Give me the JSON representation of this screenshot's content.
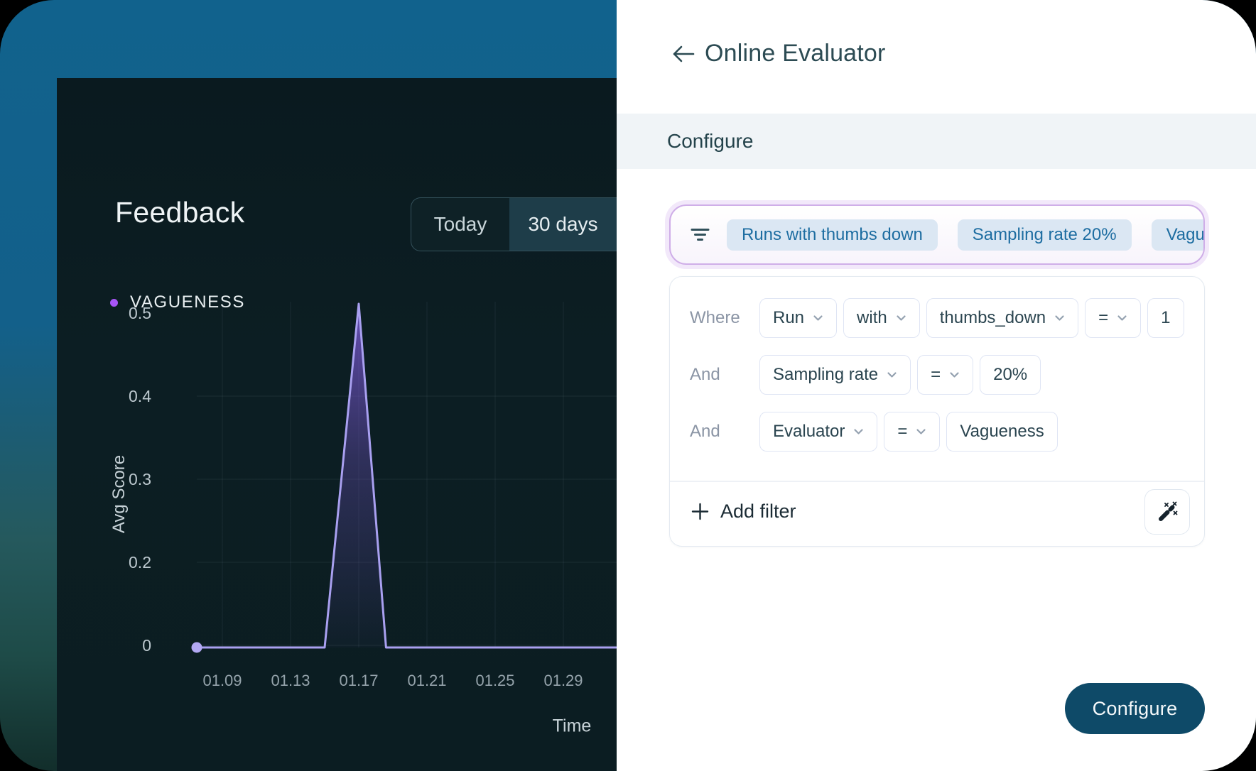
{
  "left_panel": {
    "range_buttons": [
      {
        "label": "Today",
        "active": false
      },
      {
        "label": "30 days",
        "active": true
      }
    ]
  },
  "chart_data": {
    "type": "line",
    "title": "Feedback",
    "legend": [
      {
        "label": "VAGUENESS",
        "color": "#a855f7"
      }
    ],
    "xlabel": "Time",
    "ylabel": "Avg Score",
    "x_ticks": [
      "01.09",
      "01.13",
      "01.17",
      "01.21",
      "01.25",
      "01.29"
    ],
    "x_tick_positions_days": [
      0,
      4,
      8,
      12,
      16,
      20
    ],
    "y_ticks": [
      "0.5",
      "0.4",
      "0.3",
      "0.2",
      "0"
    ],
    "ylim": [
      0,
      0.5
    ],
    "grid": true,
    "series": [
      {
        "name": "VAGUENESS",
        "color": "#a9a0f0",
        "points_days_value": [
          [
            -1.5,
            0
          ],
          [
            6,
            0
          ],
          [
            8,
            0.5
          ],
          [
            9.6,
            0
          ],
          [
            23.1,
            0
          ]
        ]
      }
    ]
  },
  "right_panel": {
    "header": {
      "title": "Online Evaluator",
      "back_icon": "arrow-left"
    },
    "section_title": "Configure",
    "filter_bar": {
      "icon": "filter-lines-icon",
      "chips": [
        "Runs with thumbs down",
        "Sampling rate 20%",
        "Vagueness"
      ]
    },
    "filter_rows": [
      {
        "connector": "Where",
        "fields": [
          {
            "label": "Run",
            "type": "select"
          },
          {
            "label": "with",
            "type": "select"
          },
          {
            "label": "thumbs_down",
            "type": "select"
          },
          {
            "label": "=",
            "type": "select"
          },
          {
            "label": "1",
            "type": "value"
          }
        ]
      },
      {
        "connector": "And",
        "fields": [
          {
            "label": "Sampling rate",
            "type": "select"
          },
          {
            "label": "=",
            "type": "select"
          },
          {
            "label": "20%",
            "type": "value"
          }
        ]
      },
      {
        "connector": "And",
        "fields": [
          {
            "label": "Evaluator",
            "type": "select"
          },
          {
            "label": "=",
            "type": "select"
          },
          {
            "label": "Vagueness",
            "type": "value"
          }
        ]
      }
    ],
    "add_filter_label": "Add filter",
    "wand_icon": "magic-wand-icon",
    "configure_button": "Configure"
  },
  "colors": {
    "accent_purple": "#a855f7",
    "line_purple": "#a9a0f0",
    "chip_bg": "#dbe7f3",
    "chip_text": "#1d6da1",
    "filter_bar_border": "#cfaee8",
    "configure_button_bg": "#0e4a68",
    "panel_dark": "#0c1e23",
    "header_text": "#2c4b53"
  }
}
